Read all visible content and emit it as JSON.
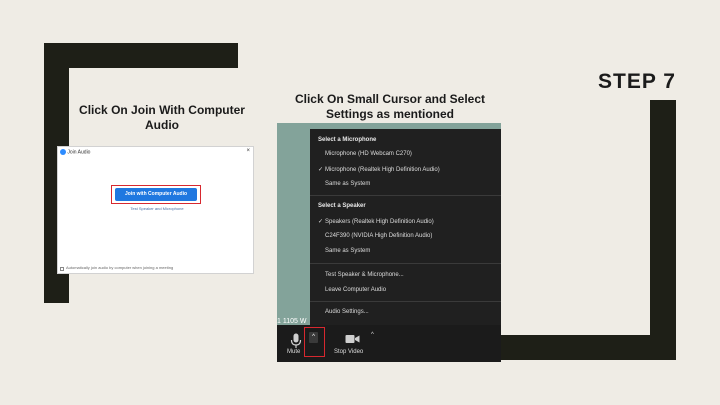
{
  "step_title": "STEP 7",
  "captions": {
    "left": "Click On Join With Computer Audio",
    "middle": "Click On Small Cursor and Select Settings as mentioned"
  },
  "join_dialog": {
    "title": "Join Audio",
    "close": "×",
    "join_button": "Join with Computer Audio",
    "test_link": "Test Speaker and Microphone",
    "auto_join_text": "Automatically join audio by computer when joining a meeting"
  },
  "zoom_menu": {
    "microphone_header": "Select a Microphone",
    "microphones": [
      {
        "label": "Microphone (HD Webcam C270)",
        "checked": false
      },
      {
        "label": "Microphone (Realtek High Definition Audio)",
        "checked": true
      },
      {
        "label": "Same as System",
        "checked": false
      }
    ],
    "speaker_header": "Select a Speaker",
    "speakers": [
      {
        "label": "Speakers (Realtek High Definition Audio)",
        "checked": true
      },
      {
        "label": "C24F390 (NVIDIA High Definition Audio)",
        "checked": false
      },
      {
        "label": "Same as System",
        "checked": false
      }
    ],
    "actions": [
      "Test Speaker & Microphone...",
      "Leave Computer Audio"
    ],
    "settings": "Audio Settings..."
  },
  "zoom_toolbar": {
    "meeting_id_fragment": "1 1105 W",
    "mute_label": "Mute",
    "stop_video_label": "Stop Video",
    "caret": "^"
  },
  "icons": {
    "mic": "microphone-icon",
    "video": "video-camera-icon",
    "check": "checkmark-icon"
  },
  "colors": {
    "background": "#efece5",
    "frame": "#1e1f17",
    "join_button": "#1f78e0",
    "highlight": "#d7282f",
    "zoom_menu": "#202020"
  }
}
